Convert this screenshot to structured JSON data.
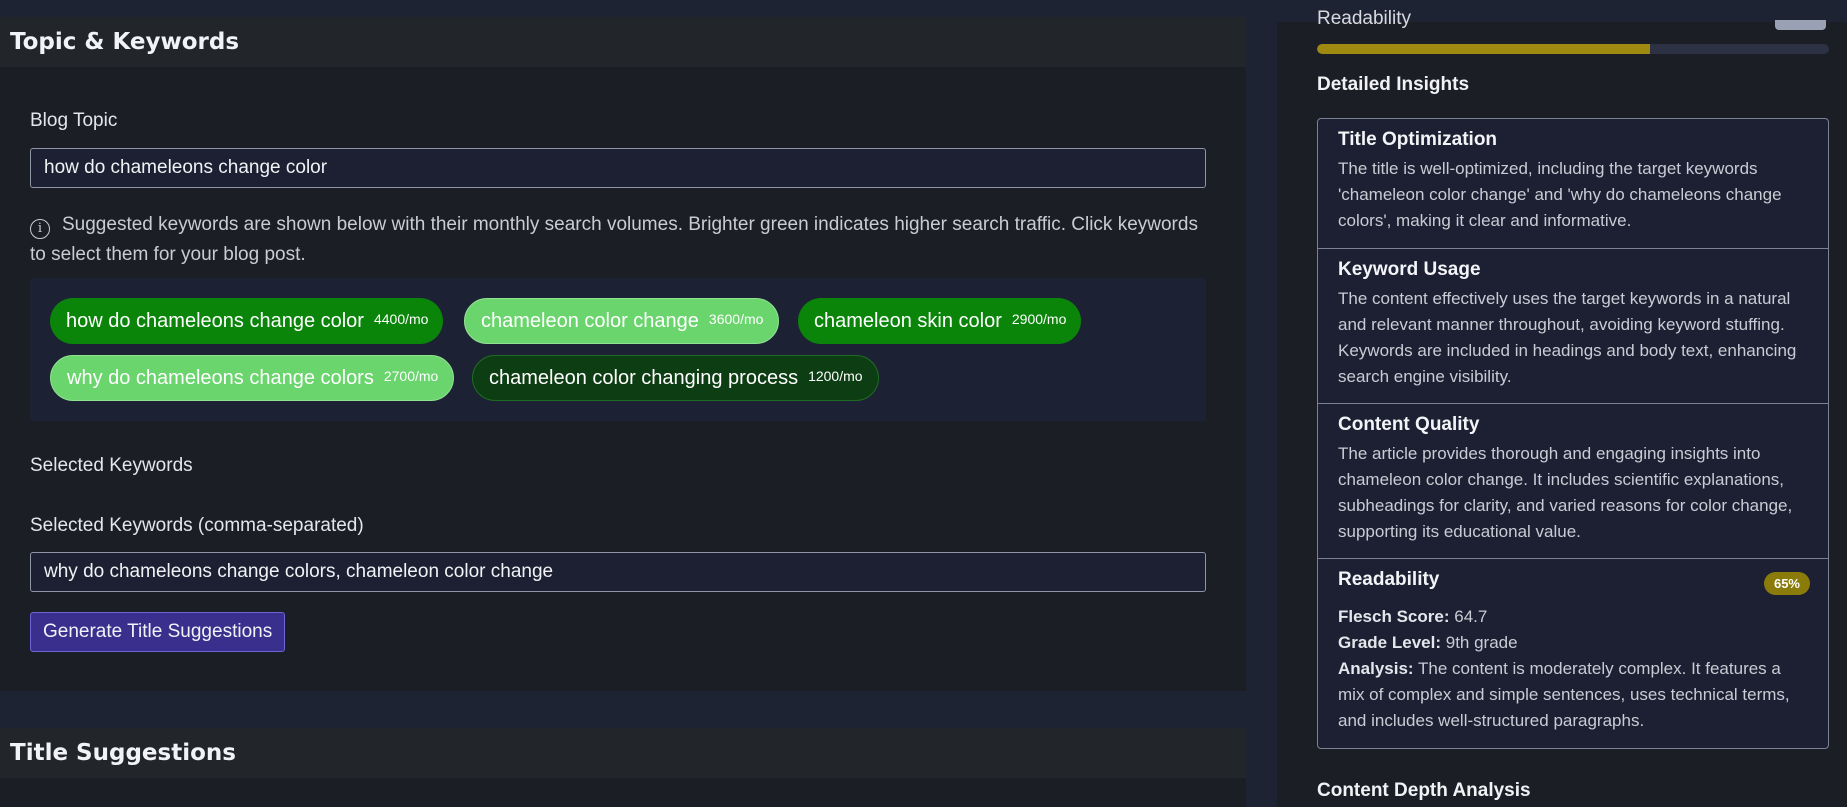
{
  "topic_panel": {
    "title": "Topic & Keywords",
    "blog_topic_label": "Blog Topic",
    "blog_topic_value": "how do chameleons change color",
    "hint_text": "Suggested keywords are shown below with their monthly search volumes. Brighter green indicates higher search traffic. Click keywords to select them for your blog post.",
    "keywords": [
      {
        "keyword": "how do chameleons change color",
        "volume": "4400/mo",
        "selected": false
      },
      {
        "keyword": "chameleon color change",
        "volume": "3600/mo",
        "selected": true
      },
      {
        "keyword": "chameleon skin color",
        "volume": "2900/mo",
        "selected": false
      },
      {
        "keyword": "why do chameleons change colors",
        "volume": "2700/mo",
        "selected": true
      },
      {
        "keyword": "chameleon color changing process",
        "volume": "1200/mo",
        "selected": false
      }
    ],
    "selected_keywords_heading": "Selected Keywords",
    "selected_keywords_label": "Selected Keywords (comma-separated)",
    "selected_keywords_value": "why do chameleons change colors, chameleon color change",
    "generate_button": "Generate Title Suggestions"
  },
  "title_panel": {
    "title": "Title Suggestions"
  },
  "analysis": {
    "readability_label": "Readability",
    "readability_fraction": 0.65,
    "detailed_insights_title": "Detailed Insights",
    "insights": [
      {
        "title": "Title Optimization",
        "text": "The title is well-optimized, including the target keywords 'chameleon color change' and 'why do chameleons change colors', making it clear and informative."
      },
      {
        "title": "Keyword Usage",
        "text": "The content effectively uses the target keywords in a natural and relevant manner throughout, avoiding keyword stuffing. Keywords are included in headings and body text, enhancing search engine visibility."
      },
      {
        "title": "Content Quality",
        "text": "The article provides thorough and engaging insights into chameleon color change. It includes scientific explanations, subheadings for clarity, and varied reasons for color change, supporting its educational value."
      }
    ],
    "readability": {
      "title": "Readability",
      "badge": "65%",
      "flesch_label": "Flesch Score:",
      "flesch_value": "64.7",
      "grade_label": "Grade Level:",
      "grade_value": "9th grade",
      "analysis_label": "Analysis:",
      "analysis_value": "The content is moderately complex. It features a mix of complex and simple sentences, uses technical terms, and includes well-structured paragraphs."
    },
    "content_depth_title": "Content Depth Analysis"
  },
  "colors": {
    "chip_high": "#0a850a",
    "chip_selected": "#6ad46d",
    "chip_low": "#0d3d12",
    "accent_button": "#3a2f8c",
    "readability_bar": "#a08910"
  }
}
